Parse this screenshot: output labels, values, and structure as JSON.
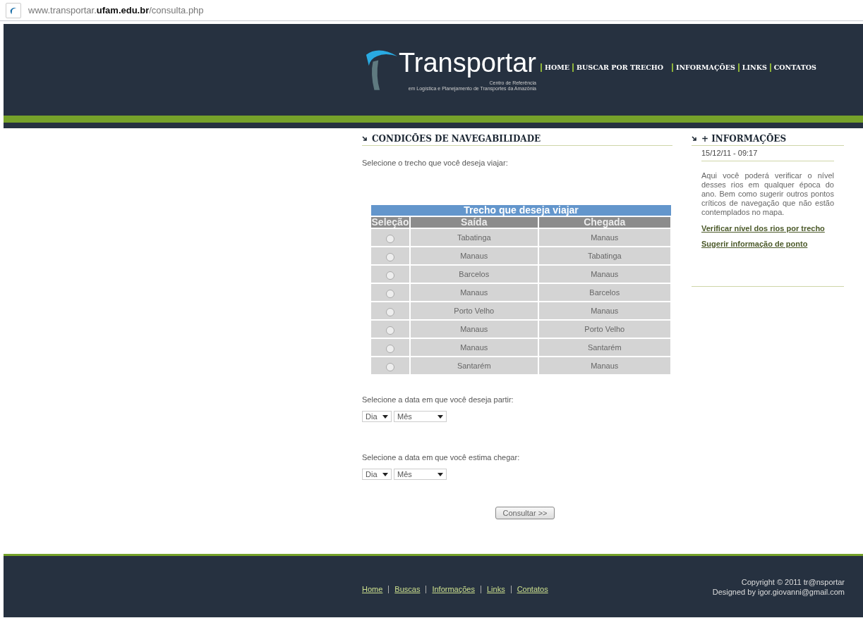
{
  "browser": {
    "url": "www.transportar.**ufam.edu.br**/consulta.php"
  },
  "header": {
    "logo_title": "Transportar",
    "logo_subtitle_1": "Centro de Referência",
    "logo_subtitle_2": "em Logística e Planejamento de Transportes da Amazônia",
    "nav": [
      "HOME",
      "BUSCAR POR TRECHO",
      "INFORMAÇÕES",
      "LINKS",
      "CONTATOS"
    ]
  },
  "main": {
    "title": "CONDICÕES DE NAVEGABILIDADE",
    "route_prompt": "Selecione o trecho que você deseja viajar:",
    "table": {
      "caption": "Trecho que deseja viajar",
      "columns": [
        "Seleção",
        "Saída",
        "Chegada"
      ],
      "rows": [
        {
          "from": "Tabatinga",
          "to": "Manaus",
          "selected": false
        },
        {
          "from": "Manaus",
          "to": "Tabatinga",
          "selected": false
        },
        {
          "from": "Barcelos",
          "to": "Manaus",
          "selected": false
        },
        {
          "from": "Manaus",
          "to": "Barcelos",
          "selected": false
        },
        {
          "from": "Porto Velho",
          "to": "Manaus",
          "selected": false
        },
        {
          "from": "Manaus",
          "to": "Porto Velho",
          "selected": false
        },
        {
          "from": "Manaus",
          "to": "Santarém",
          "selected": false
        },
        {
          "from": "Santarém",
          "to": "Manaus",
          "selected": false
        }
      ]
    },
    "date_groups": [
      {
        "prompt": "Selecione a data em que você deseja partir:",
        "day": "Dia",
        "month": "Mês"
      },
      {
        "prompt": "Selecione a data em que você estima chegar:",
        "day": "Dia",
        "month": "Mês"
      }
    ],
    "submit": "Consultar >>"
  },
  "sidebar": {
    "title": "+ INFORMAÇÕES",
    "datetime": "15/12/11 - 09:17",
    "text": "Aqui você poderá verificar o nível desses rios em qualquer época do ano. Bem como sugerir outros pontos críticos de navegação que não estão contemplados no mapa.",
    "links": [
      "Verificar nível dos rios por trecho",
      "Sugerir informação de ponto"
    ]
  },
  "footer": {
    "links": [
      "Home",
      "Buscas",
      "Informações",
      "Links",
      "Contatos"
    ],
    "copyright": "Copyright © 2011 tr@nsportar",
    "designer": "Designed by igor.giovanni@gmail.com"
  }
}
